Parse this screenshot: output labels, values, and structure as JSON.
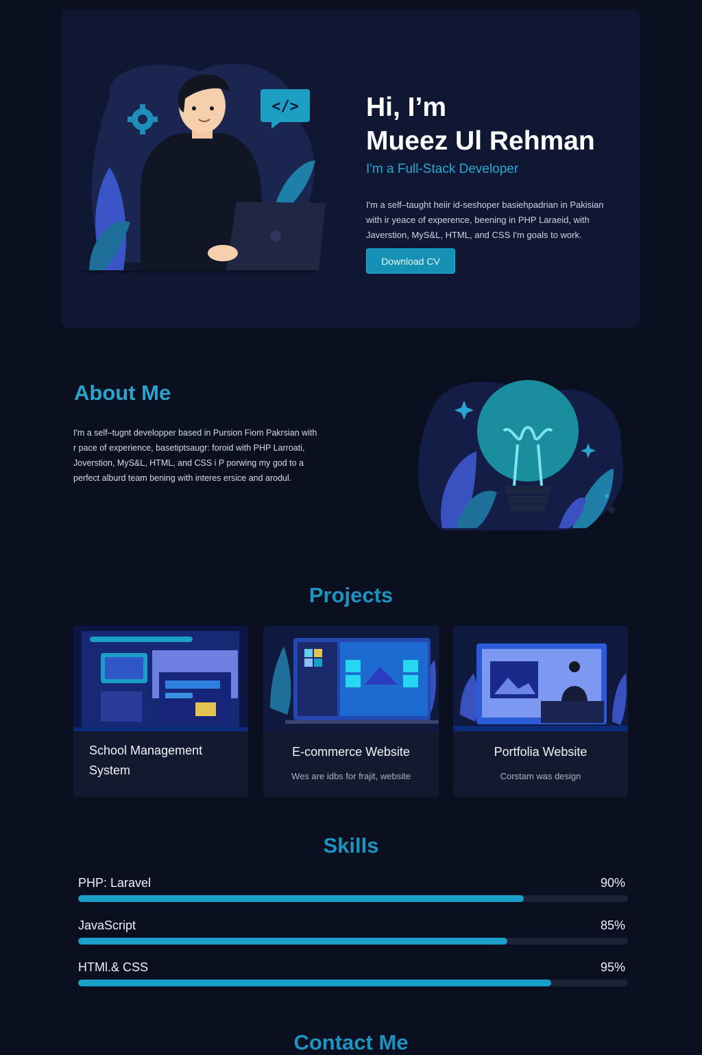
{
  "hero": {
    "greeting_line1": "Hi, I’m",
    "greeting_line2": "Mueez Ul Rehman",
    "subtitle": "I'm a Full-Stack Developer",
    "description": "I'm a self–taught heiir id-seshoper basiehpadrian in Pakisian with ir yeace of experence, beening  in PHP Laraeid, with Javerstion, MyS&L, HTML, and CSS I'm goals to work.",
    "button_label": "Download CV"
  },
  "about": {
    "title": "About Me",
    "description": "I'm a self–tugnt developper based in Pursion Fiom Pakrsian with r pace of experience, basetiptsaugr: foroid with PHP Larroati, Joverstion, MyS&L, HTML, and CSS i P porwing my god to a perfect alburd team bening with interes ersice and arodul."
  },
  "projects": {
    "title": "Projects",
    "items": [
      {
        "title": "School Management System",
        "subtitle": ""
      },
      {
        "title": "E-commerce Website",
        "subtitle": "Wes are idbs for frajit, website"
      },
      {
        "title": "Portfolia Website",
        "subtitle": "Corstam was design"
      }
    ]
  },
  "skills": {
    "title": "Skills",
    "items": [
      {
        "name": "PHP: Laravel",
        "percent_label": "90%",
        "level": 0.81
      },
      {
        "name": "JavaScript",
        "percent_label": "85%",
        "level": 0.78
      },
      {
        "name": "HTMl.& CSS",
        "percent_label": "95%",
        "level": 0.86
      }
    ]
  },
  "contact": {
    "title": "Contact Me"
  },
  "colors": {
    "accent": "#1aa0c8",
    "background": "#0b1020",
    "card": "#131a30"
  }
}
